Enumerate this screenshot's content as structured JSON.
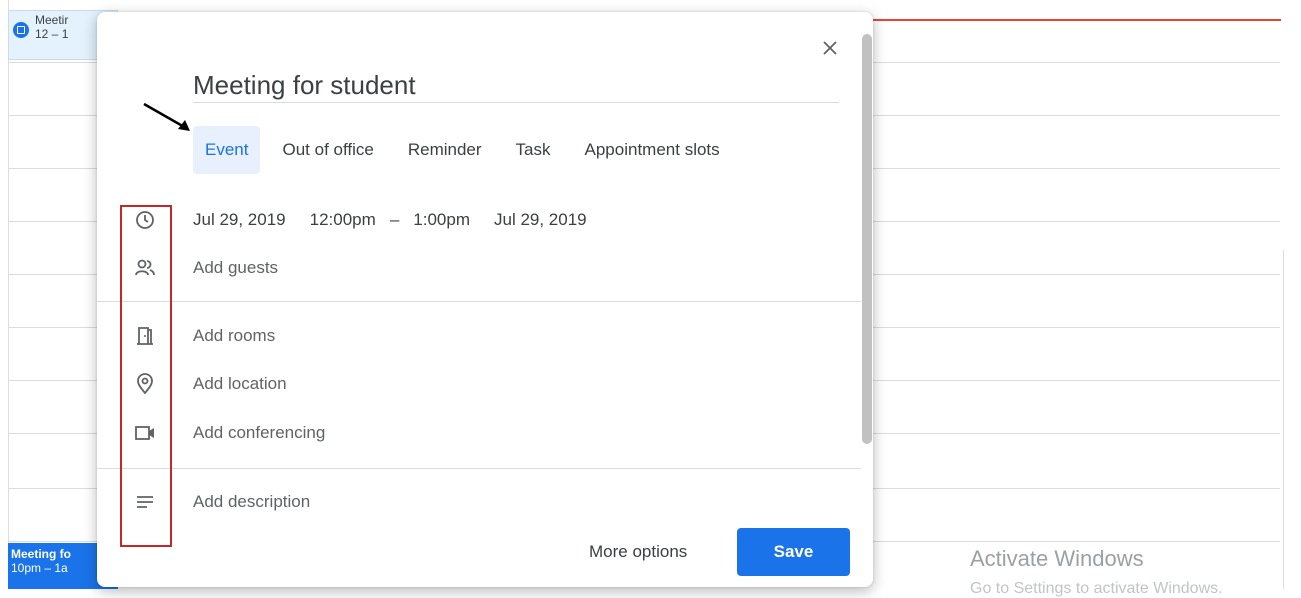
{
  "calendar": {
    "top_event": {
      "title": "Meetir",
      "time": "12 – 1"
    },
    "bottom_event": {
      "title": "Meeting fo",
      "time": "10pm – 1a"
    }
  },
  "dialog": {
    "title_value": "Meeting for student",
    "close_icon": "close-icon",
    "tabs": [
      {
        "label": "Event",
        "active": true
      },
      {
        "label": "Out of office",
        "active": false
      },
      {
        "label": "Reminder",
        "active": false
      },
      {
        "label": "Task",
        "active": false
      },
      {
        "label": "Appointment slots",
        "active": false
      }
    ],
    "datetime": {
      "start_date": "Jul 29, 2019",
      "start_time": "12:00pm",
      "separator": "–",
      "end_time": "1:00pm",
      "end_date": "Jul 29, 2019"
    },
    "fields": {
      "guests": "Add guests",
      "rooms": "Add rooms",
      "location": "Add location",
      "conferencing": "Add conferencing",
      "description": "Add description"
    },
    "buttons": {
      "more_options": "More options",
      "save": "Save"
    }
  },
  "watermark": {
    "line1": "Activate Windows",
    "line2": "Go to Settings to activate Windows."
  },
  "colors": {
    "accent": "#1a73e8",
    "tab_active_bg": "#e8f0fe",
    "now_line": "#ea4335",
    "annotation": "#c62828"
  }
}
